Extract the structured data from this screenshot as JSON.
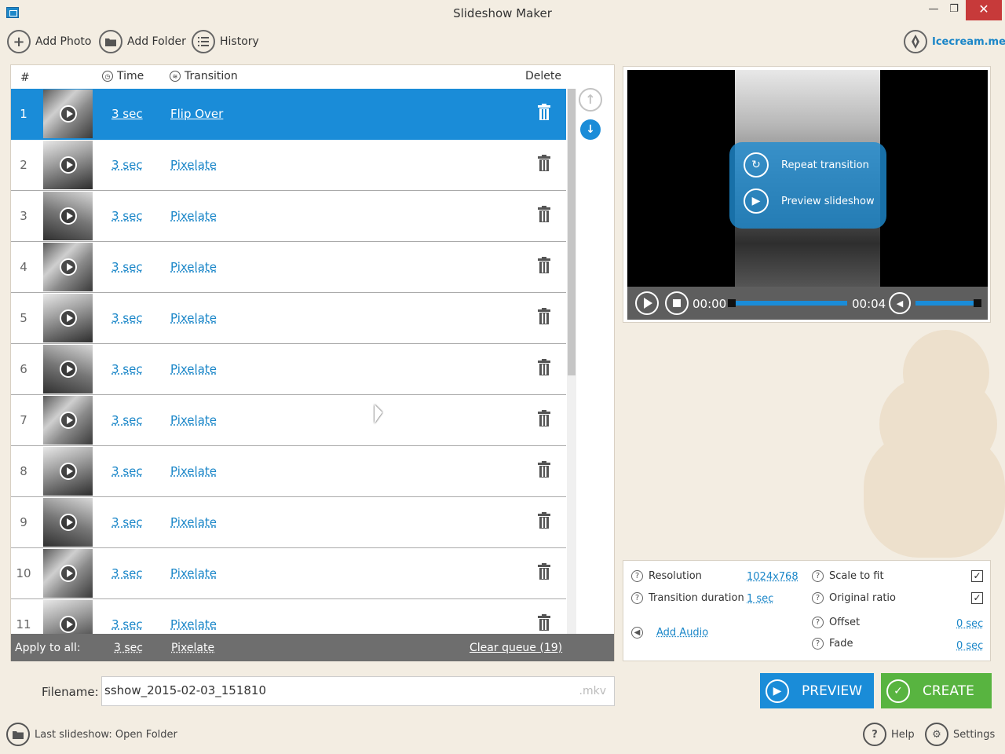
{
  "window": {
    "title": "Slideshow Maker",
    "minimize_icon": "—",
    "maximize_icon": "❐",
    "close_icon": "✕"
  },
  "toolbar": {
    "add_photo": "Add Photo",
    "add_folder": "Add Folder",
    "history": "History",
    "icecream_link": "Icecream.me"
  },
  "queue": {
    "header": {
      "num": "#",
      "time": "Time",
      "transition": "Transition",
      "delete": "Delete"
    },
    "rows": [
      {
        "num": "1",
        "time": "3 sec",
        "transition": "Flip Over",
        "selected": true
      },
      {
        "num": "2",
        "time": "3 sec",
        "transition": "Pixelate"
      },
      {
        "num": "3",
        "time": "3 sec",
        "transition": "Pixelate"
      },
      {
        "num": "4",
        "time": "3 sec",
        "transition": "Pixelate"
      },
      {
        "num": "5",
        "time": "3 sec",
        "transition": "Pixelate"
      },
      {
        "num": "6",
        "time": "3 sec",
        "transition": "Pixelate"
      },
      {
        "num": "7",
        "time": "3 sec",
        "transition": "Pixelate"
      },
      {
        "num": "8",
        "time": "3 sec",
        "transition": "Pixelate"
      },
      {
        "num": "9",
        "time": "3 sec",
        "transition": "Pixelate"
      },
      {
        "num": "10",
        "time": "3 sec",
        "transition": "Pixelate"
      },
      {
        "num": "11",
        "time": "3 sec",
        "transition": "Pixelate"
      }
    ],
    "apply_to_all": {
      "label": "Apply to all:",
      "time": "3 sec",
      "transition": "Pixelate",
      "clear_queue": "Clear queue (19)"
    }
  },
  "filename": {
    "label": "Filename:",
    "value": "sshow_2015-02-03_151810",
    "extension": ".mkv"
  },
  "footer": {
    "last_slideshow": "Last slideshow: Open Folder",
    "help": "Help",
    "settings": "Settings"
  },
  "player": {
    "repeat_transition": "Repeat transition",
    "preview_slideshow": "Preview slideshow",
    "current_time": "00:00",
    "end_time": "00:04",
    "volume_level": 1.0
  },
  "settings": {
    "resolution_label": "Resolution",
    "resolution_value": "1024x768",
    "transition_duration_label": "Transition duration",
    "transition_duration_value": "1 sec",
    "add_audio": "Add Audio",
    "scale_to_fit_label": "Scale to fit",
    "scale_to_fit_checked": true,
    "original_ratio_label": "Original ratio",
    "original_ratio_checked": true,
    "offset_label": "Offset",
    "offset_value": "0 sec",
    "fade_label": "Fade",
    "fade_value": "0 sec",
    "help_mark": "?",
    "check_mark": "✓"
  },
  "actions": {
    "preview": "PREVIEW",
    "create": "CREATE"
  },
  "colors": {
    "background": "#f3ede2",
    "accent_blue": "#1a8cd8",
    "create_green": "#58b440",
    "apply_bar": "#6e6e6e"
  }
}
